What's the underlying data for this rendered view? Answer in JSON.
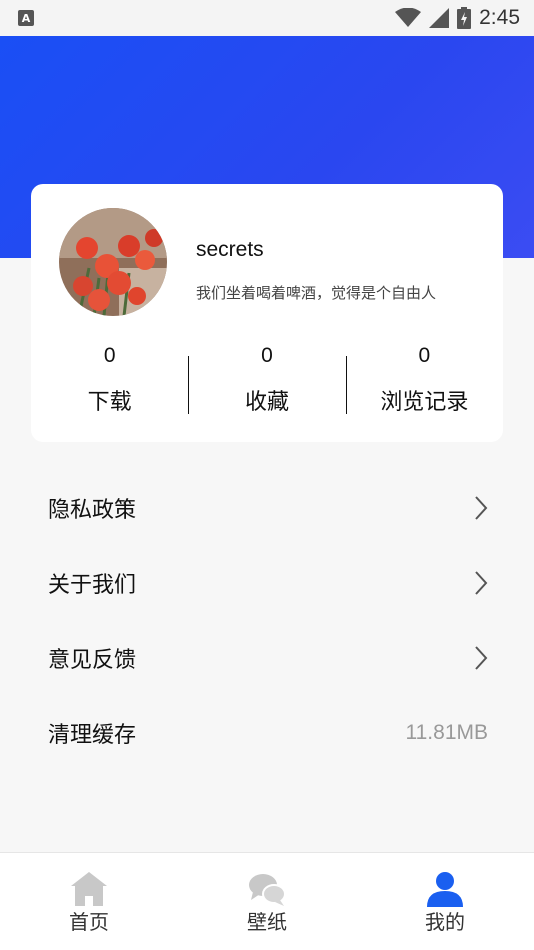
{
  "status_bar": {
    "notification_icon": "A",
    "time": "2:45",
    "icons": [
      "wifi-icon",
      "signal-icon",
      "battery-charging-icon"
    ]
  },
  "profile": {
    "username": "secrets",
    "bio": "我们坐着喝着啤酒，觉得是个自由人",
    "avatar_icon": "roses-avatar"
  },
  "stats": [
    {
      "value": "0",
      "label": "下载"
    },
    {
      "value": "0",
      "label": "收藏"
    },
    {
      "value": "0",
      "label": "浏览记录"
    }
  ],
  "menu": [
    {
      "label": "隐私政策",
      "icon": "chevron-right-icon"
    },
    {
      "label": "关于我们",
      "icon": "chevron-right-icon"
    },
    {
      "label": "意见反馈",
      "icon": "chevron-right-icon"
    },
    {
      "label": "清理缓存",
      "value": "11.81MB"
    }
  ],
  "tabs": [
    {
      "label": "首页",
      "icon": "home-icon",
      "active": false
    },
    {
      "label": "壁纸",
      "icon": "chat-bubbles-icon",
      "active": false
    },
    {
      "label": "我的",
      "icon": "user-icon",
      "active": true
    }
  ],
  "colors": {
    "header_blue": "#1a4ff5",
    "active_tab": "#1a5ff0",
    "inactive_tab": "#c8c8c8"
  }
}
